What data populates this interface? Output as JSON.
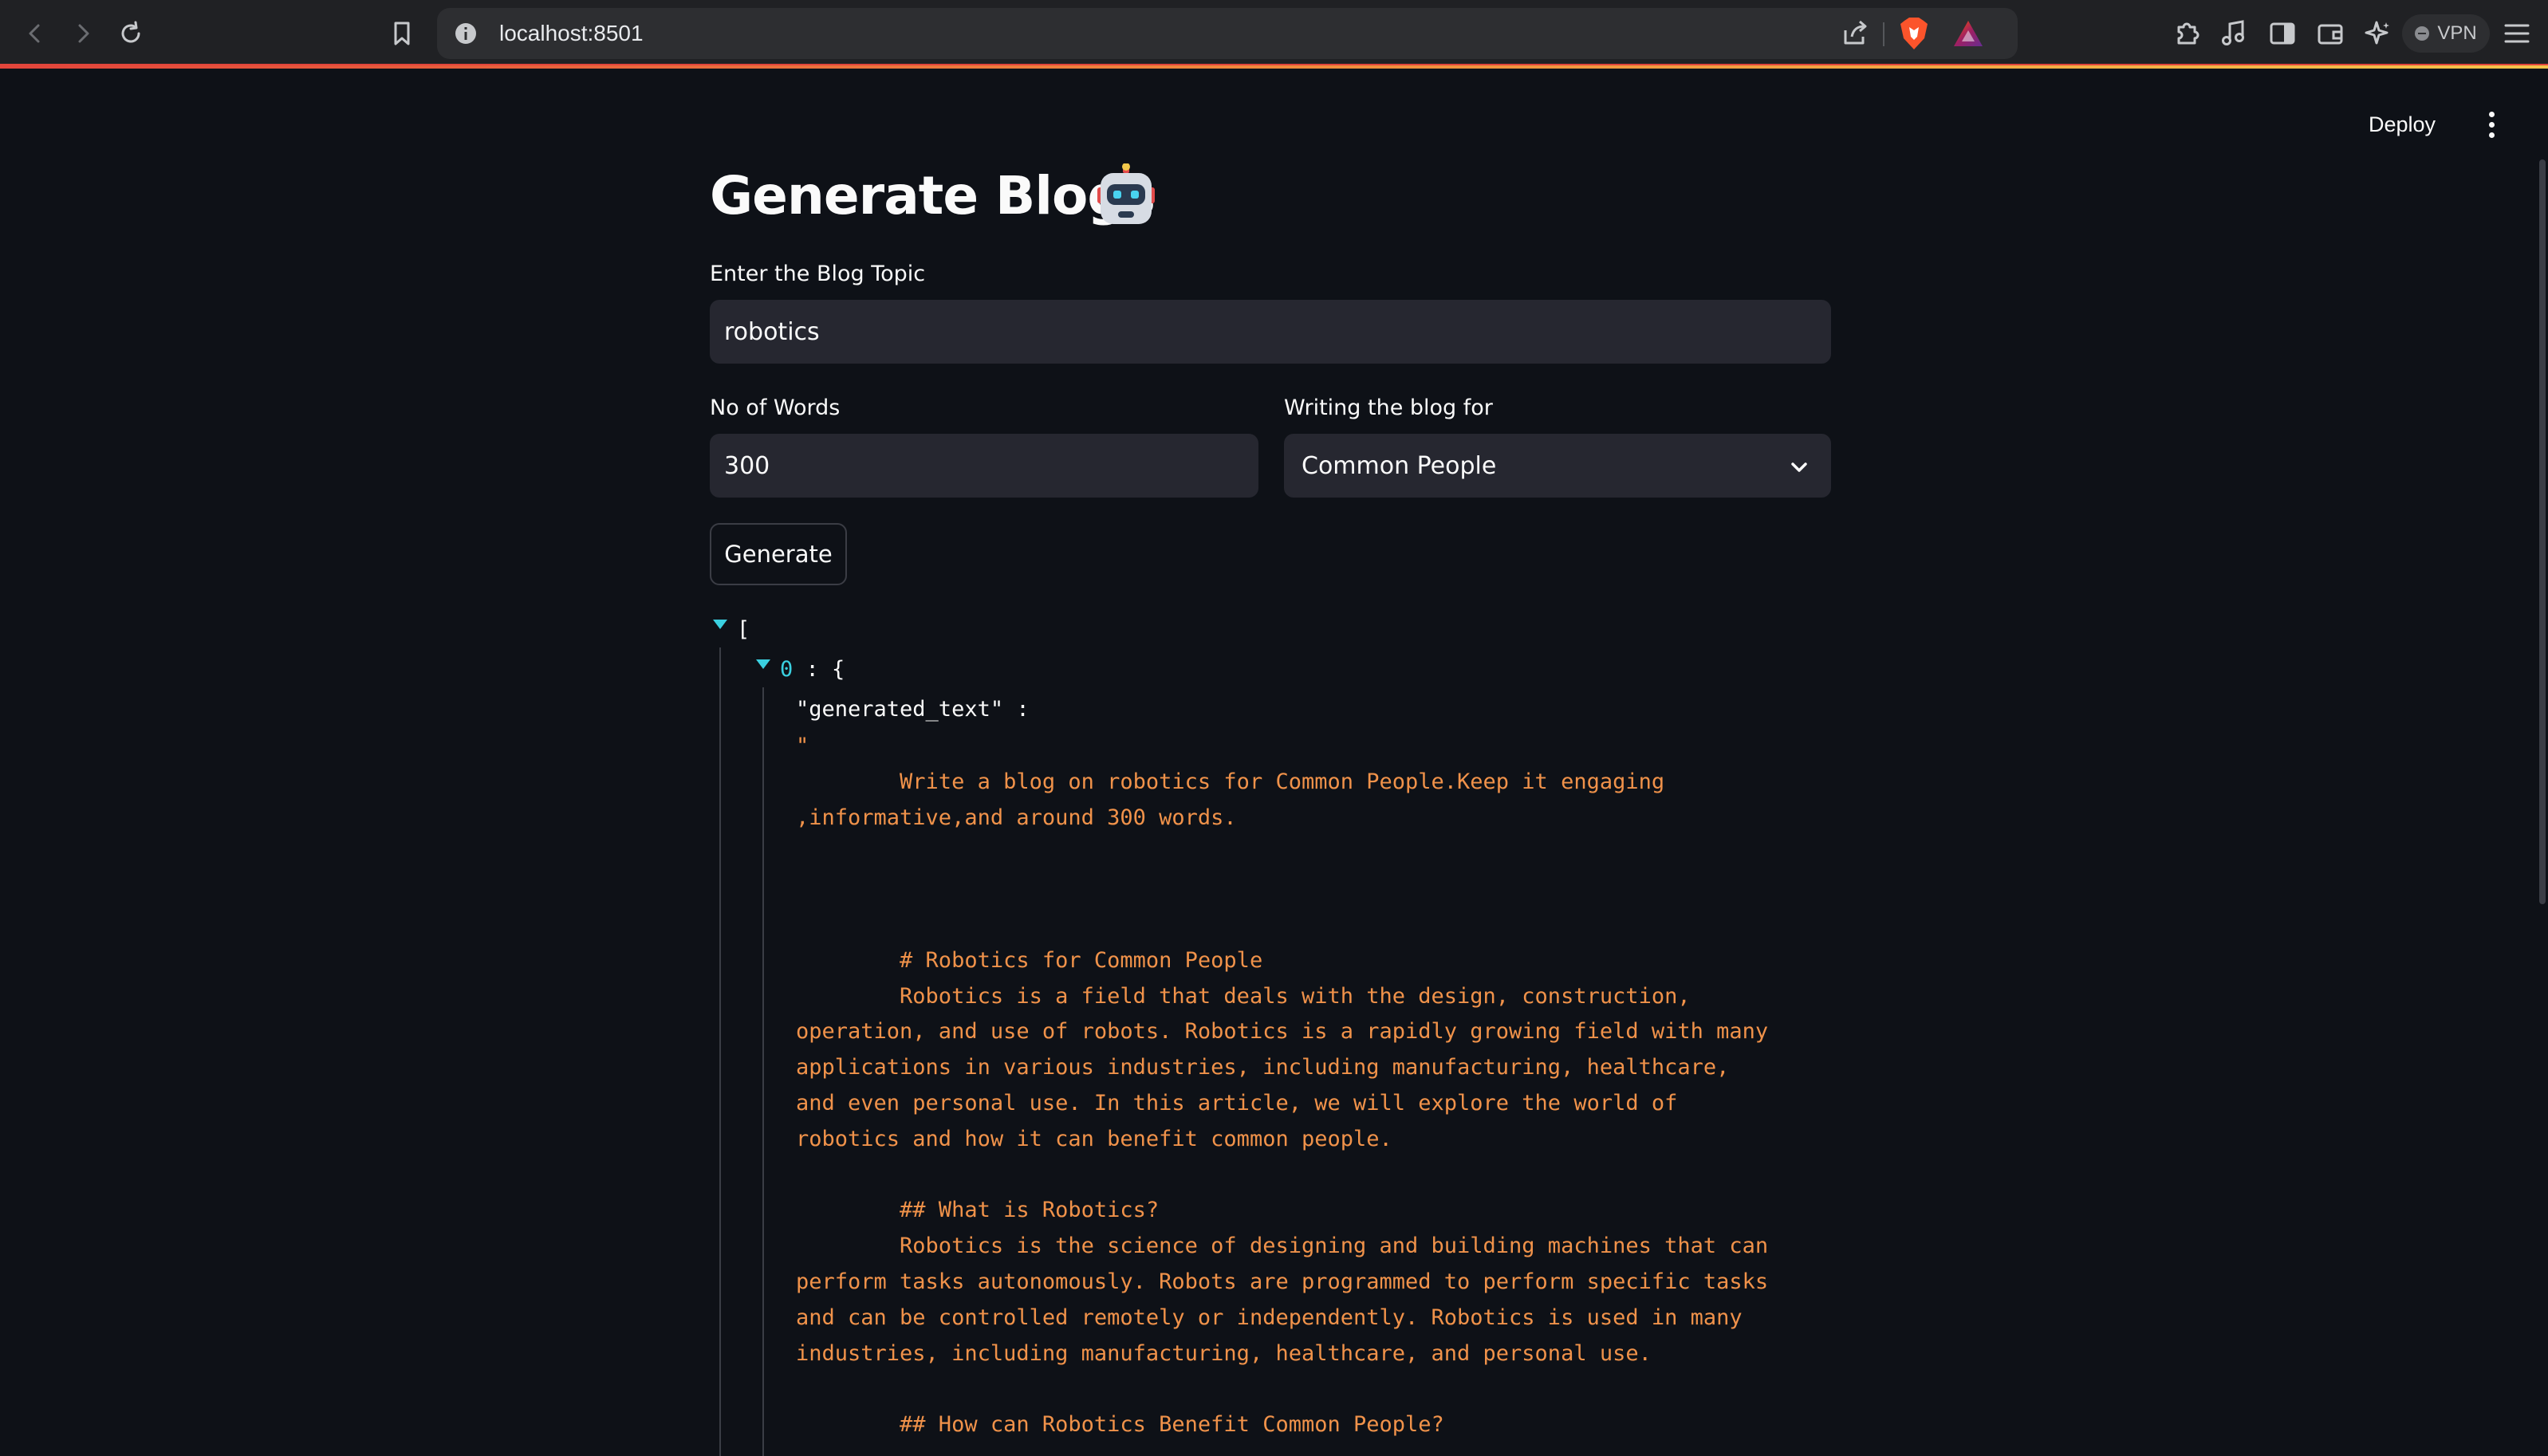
{
  "browser": {
    "url": "localhost:8501",
    "vpn_label": "VPN"
  },
  "app": {
    "deploy_label": "Deploy",
    "title": "Generate Blogs",
    "topic": {
      "label": "Enter the Blog Topic",
      "value": "robotics"
    },
    "words": {
      "label": "No of Words",
      "value": "300"
    },
    "audience": {
      "label": "Writing the blog for",
      "selected": "Common People"
    },
    "generate_label": "Generate"
  },
  "output": {
    "open_bracket": "[",
    "item_index": "0",
    "item_sep": " : {",
    "key": "\"generated_text\" :",
    "text": "\"\n        Write a blog on robotics for Common People.Keep it engaging\n,informative,and around 300 words.\n\n\n\n        # Robotics for Common People\n        Robotics is a field that deals with the design, construction,\noperation, and use of robots. Robotics is a rapidly growing field with many\napplications in various industries, including manufacturing, healthcare,\nand even personal use. In this article, we will explore the world of\nrobotics and how it can benefit common people.\n\n        ## What is Robotics?\n        Robotics is the science of designing and building machines that can\nperform tasks autonomously. Robots are programmed to perform specific tasks\nand can be controlled remotely or independently. Robotics is used in many\nindustries, including manufacturing, healthcare, and personal use.\n\n        ## How can Robotics Benefit Common People?"
  }
}
